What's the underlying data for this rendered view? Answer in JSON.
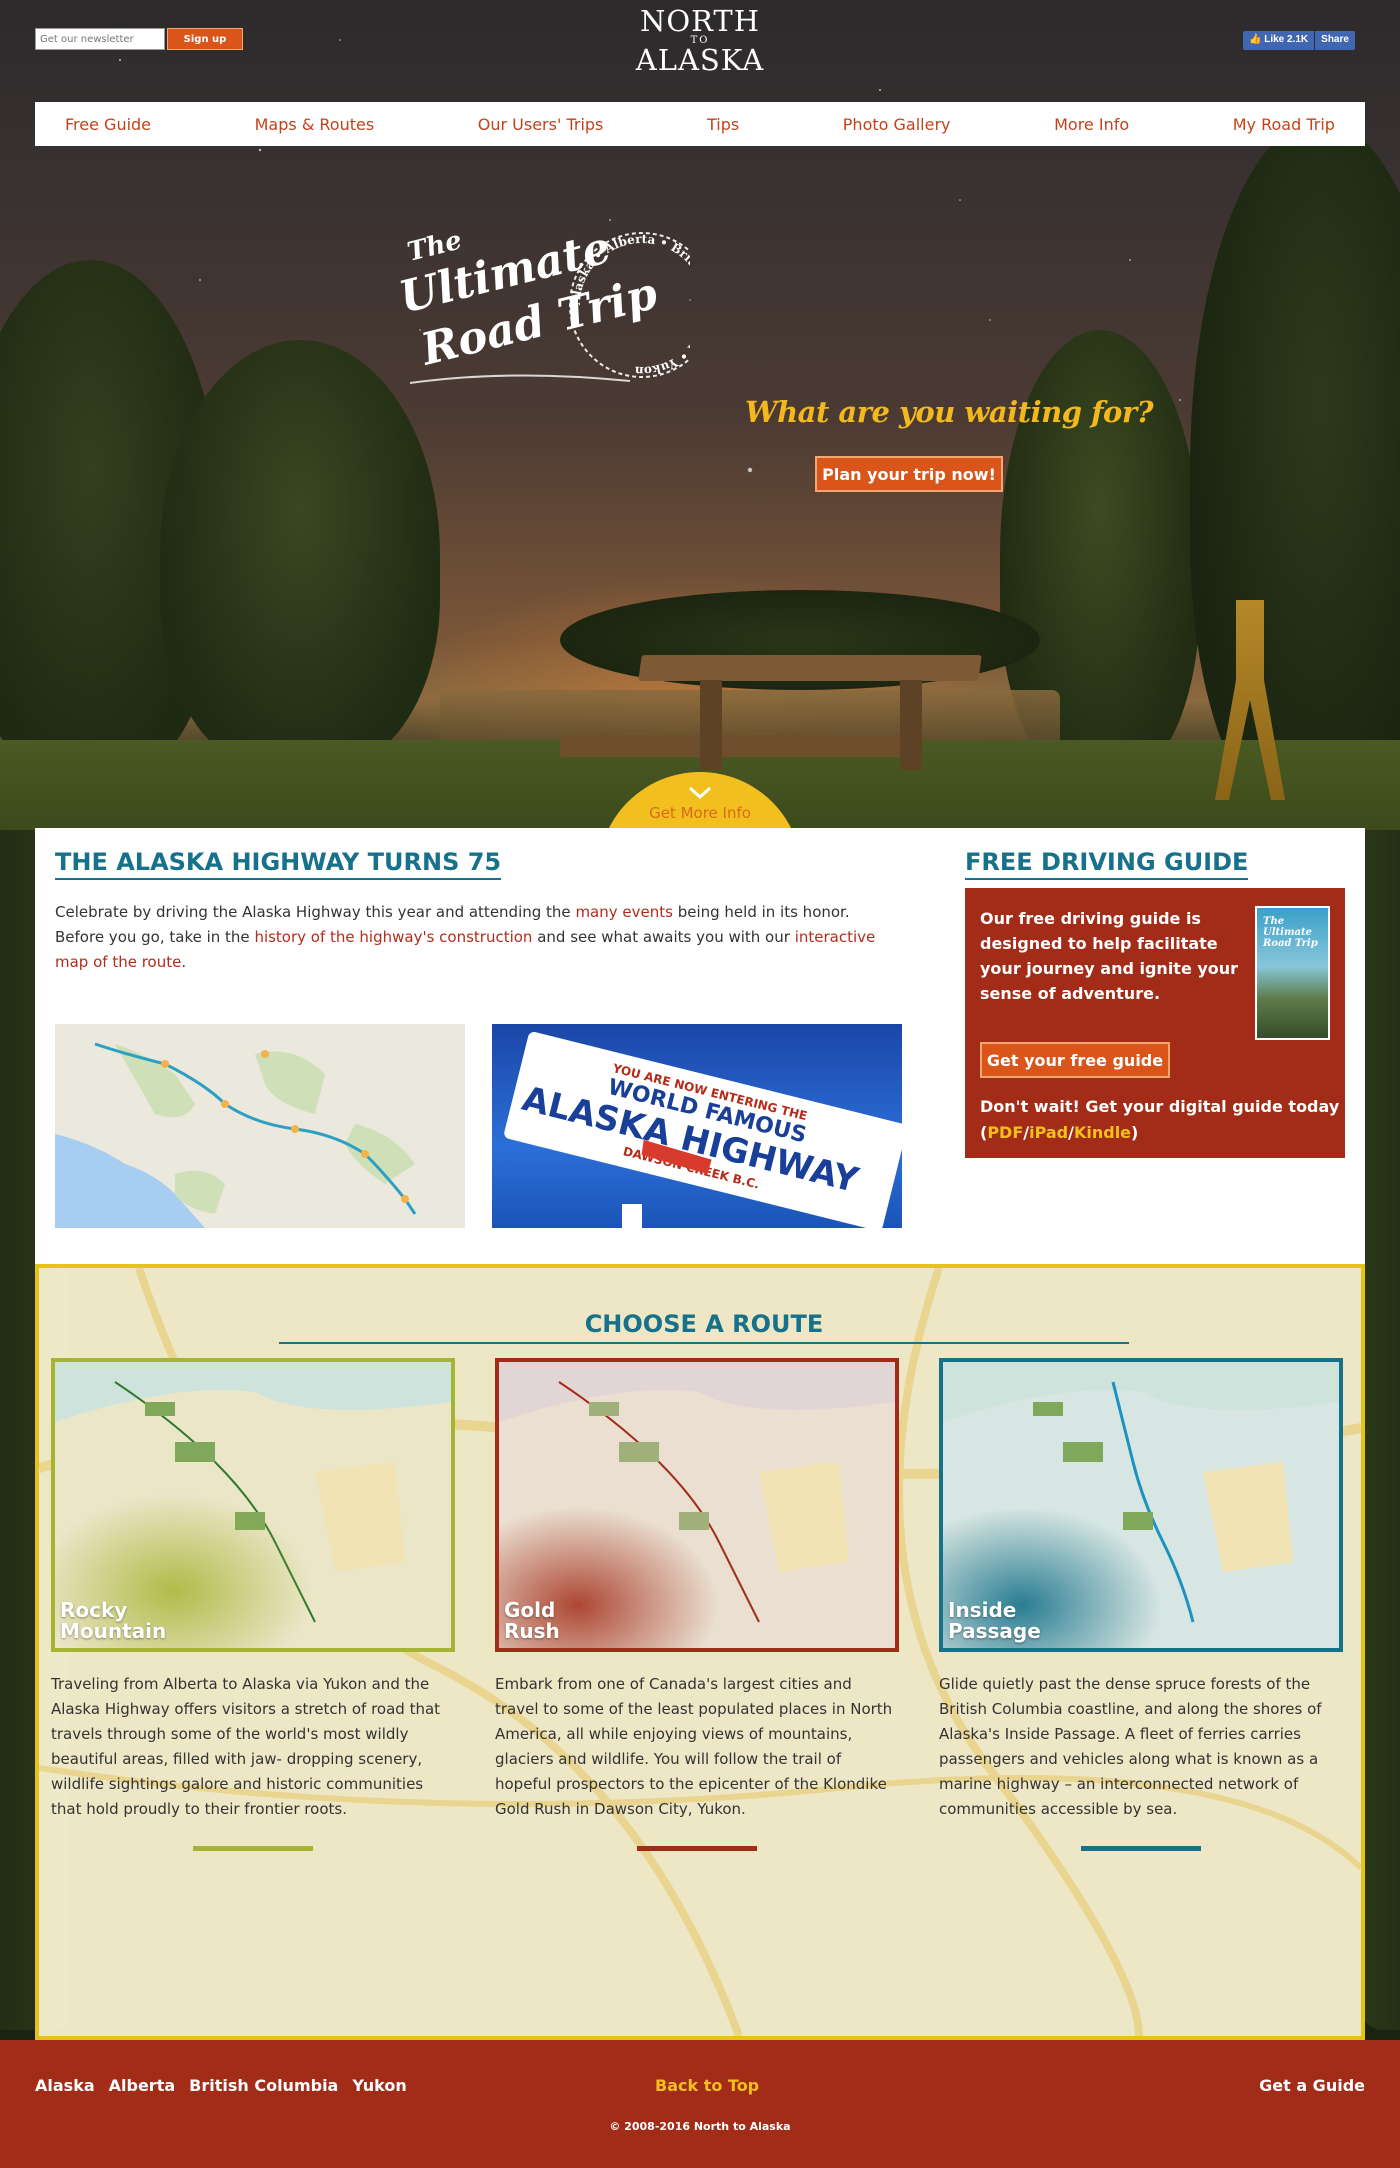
{
  "newsletter": {
    "placeholder": "Get our newsletter",
    "button": "Sign up"
  },
  "logo": {
    "line1": "NORTH",
    "line2": "TO",
    "line3": "ALASKA"
  },
  "facebook": {
    "like": "Like 2.1K",
    "share": "Share",
    "color": "#4267b2"
  },
  "nav": [
    "Free Guide",
    "Maps & Routes",
    "Our Users' Trips",
    "Tips",
    "Photo Gallery",
    "More Info",
    "My Road Trip"
  ],
  "hero": {
    "stamp_the": "The",
    "stamp_line1": "Ultimate",
    "stamp_line2": "Road Trip",
    "stamp_ring": "Alaska • Alberta • British Columbia • Yukon",
    "tagline": "What are you waiting for?",
    "cta": "Plan your trip now!",
    "more_info": "Get More Info"
  },
  "highway": {
    "title": "THE ALASKA HIGHWAY TURNS 75",
    "p1": "Celebrate by driving the Alaska Highway this year and attending the ",
    "link1": "many events",
    "p2": " being held in its honor. Before you go, take in the ",
    "link2": "history of the highway's construction",
    "p3": " and see what awaits you with our ",
    "link3": "interactive map of the route",
    "p4": ".",
    "sign_top": "YOU ARE NOW ENTERING THE",
    "sign_mid": "WORLD FAMOUS",
    "sign_main": "ALASKA HIGHWAY",
    "sign_sub": "DAWSON CREEK B.C."
  },
  "guide": {
    "title": "FREE DRIVING GUIDE",
    "text": "Our free driving guide is designed to help facilitate your journey and ignite your sense of adventure.",
    "cover_title": "The Ultimate Road Trip",
    "button": "Get your free guide",
    "digital": "Don't wait! Get your digital guide today",
    "formats": [
      "PDF",
      "iPad",
      "Kindle"
    ]
  },
  "routes": {
    "title": "CHOOSE A ROUTE",
    "items": [
      {
        "name_line1": "Rocky",
        "name_line2": "Mountain",
        "color": "#a6b433",
        "desc": "Traveling from Alberta to Alaska via Yukon and the Alaska Highway offers visitors a stretch of road that travels through some of the world's most wildly beautiful areas, filled with jaw- dropping scenery, wildlife sightings galore and historic communities that hold proudly to their frontier roots."
      },
      {
        "name_line1": "Gold",
        "name_line2": "Rush",
        "color": "#a32c19",
        "desc": "Embark from one of Canada's largest cities and travel to some of the least populated places in North America, all while enjoying views of mountains, glaciers and wildlife. You will follow the trail of hopeful prospectors to the epicenter of the Klondike Gold Rush in Dawson City, Yukon."
      },
      {
        "name_line1": "Inside",
        "name_line2": "Passage",
        "color": "#17718a",
        "desc": "Glide quietly past the dense spruce forests of the British Columbia coastline, and along the shores of Alaska's Inside Passage. A fleet of ferries carries passengers and vehicles along what is known as a marine highway – an interconnected network of communities accessible by sea."
      }
    ]
  },
  "footer": {
    "links": [
      "Alaska",
      "Alberta",
      "British Columbia",
      "Yukon"
    ],
    "back_to_top": "Back to Top",
    "get_guide": "Get a Guide",
    "copyright": "© 2008-2016 North to Alaska"
  },
  "colors": {
    "accent_orange": "#d9551a",
    "brand_red": "#a32c19",
    "teal": "#17718a",
    "gold": "#f2c01e"
  }
}
